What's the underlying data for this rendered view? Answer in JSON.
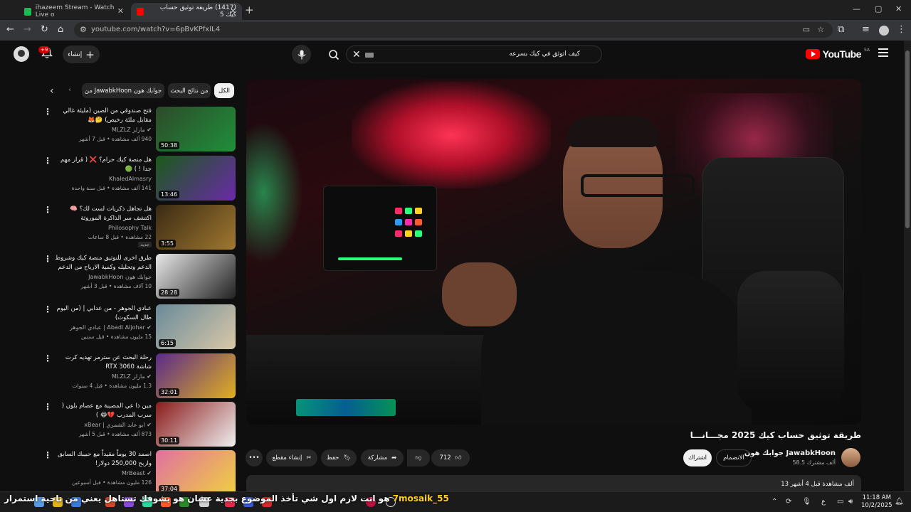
{
  "browser": {
    "tabs": [
      {
        "label": "ihazeem Stream - Watch Live o",
        "favicon_color": "#1db954",
        "active": false
      },
      {
        "label": "(1417) طريقة توثيق حساب كيك 5",
        "favicon_color": "#ff0000",
        "active": true
      }
    ],
    "url": "youtube.com/watch?v=6pBvKPfxIL4"
  },
  "yt": {
    "logo_text": "YouTube",
    "country_code": "SA",
    "search_query": "كيف اتوثق في كيك بسرعه",
    "create_label": "إنشاء",
    "notif_count": "+9"
  },
  "video": {
    "title": "طريقة توثيق حساب كيك 2025 مجـــانـــا",
    "channel_name": "جوابك هون JawabkHoon",
    "subscribers": "58.5 ألف مشترك",
    "join_label": "الانضمام",
    "subscribe_label": "اشتراك",
    "likes": "712",
    "share_label": "مشاركة",
    "save_label": "حفظ",
    "clip_label": "إنشاء مقطع",
    "views_line": "13 ألف مشاهدة قبل 4 أشهر"
  },
  "chips": [
    {
      "label": "الكل",
      "selected": true
    },
    {
      "label": "من نتائج البحث",
      "selected": false
    },
    {
      "label": "من JawabkHoon جوابك هون",
      "selected": false
    }
  ],
  "recommendations": [
    {
      "title": "فتح صندوقي من الصين (مليئة غالي مقابل ملئة رخيص) 🤔🦊",
      "channel": "مازلز MLZLZ",
      "verified": true,
      "meta": "940 ألف مشاهدة • قبل 7 أشهر",
      "duration": "50:38",
      "thumb_bg": "#2d4a2a",
      "thumb_accent": "#1f8f3a"
    },
    {
      "title": "هل منصة كيك حرام؟ ❌ ( قرار مهم جدا ! ) 🟢",
      "channel": "KhaledAlmasry",
      "verified": false,
      "meta": "141 ألف مشاهدة • قبل سنة واحدة",
      "duration": "13:46",
      "thumb_bg": "#1a5a1a",
      "thumb_accent": "#6a2aa8"
    },
    {
      "title": "هل تجاهل ذكريات لست لك؟ 🧠 اكتشف سر الذاكرة الموروثة",
      "channel": "Philosophy Talk",
      "verified": false,
      "meta": "22 مشاهدة • قبل 8 ساعات",
      "badge": "جديد",
      "duration": "3:55",
      "thumb_bg": "#3a2a14",
      "thumb_accent": "#a07830"
    },
    {
      "title": "طرق اخرى للتوثيق منصة كيك وشروط الدعم وتحليله وكمية الارباح من الدعم",
      "channel": "جوابك هون JawabkHoon",
      "verified": false,
      "meta": "10 آلاف مشاهدة • قبل 3 أشهر",
      "duration": "28:28",
      "thumb_bg": "#e8e8e8",
      "thumb_accent": "#222222"
    },
    {
      "title": "عبادي الجوهر - من عدابي | (من اليوم طال السكوت)",
      "channel": "Abadi Aljohar | عبادي الجوهر",
      "verified": true,
      "meta": "15 مليون مشاهدة • قبل سنتين",
      "duration": "6:15",
      "thumb_bg": "#6a8a9a",
      "thumb_accent": "#d8c8a8"
    },
    {
      "title": "رحلة البحث عن سترمر تهديه كرت شاشة RTX 3060",
      "channel": "مازلز MLZLZ",
      "verified": true,
      "meta": "1.3 مليون مشاهدة • قبل 4 سنوات",
      "duration": "32:01",
      "thumb_bg": "#5a2a8a",
      "thumb_accent": "#e0b020"
    },
    {
      "title": "مين ذا عي المصيبة مع عصام بلون ( سرب المدرب 💔😂 )",
      "channel": "ابو عابد الشمري | xBear",
      "verified": true,
      "meta": "873 ألف مشاهدة • قبل 5 أشهر",
      "duration": "30:11",
      "thumb_bg": "#8a1a1a",
      "thumb_accent": "#f0f0f0"
    },
    {
      "title": "اصمد 30 يوماً مقيداً مع حبيبك السابق واربح 250,000 دولار!",
      "channel": "MrBeast",
      "verified": true,
      "meta": "126 مليون مشاهدة • قبل أسبوعين",
      "duration": "37:04",
      "thumb_bg": "#e070a0",
      "thumb_accent": "#f0d040"
    }
  ],
  "taskbar": {
    "ticker_user": "7mosaik_55",
    "ticker_text": "هو انت لازم اول شي تأخذ الموضوع بجدية عشان هو يشوفك تستاهل يعني من ناحية استمرار",
    "time": "11:18 AM",
    "date": "10/2/2025",
    "lang": "ع"
  }
}
